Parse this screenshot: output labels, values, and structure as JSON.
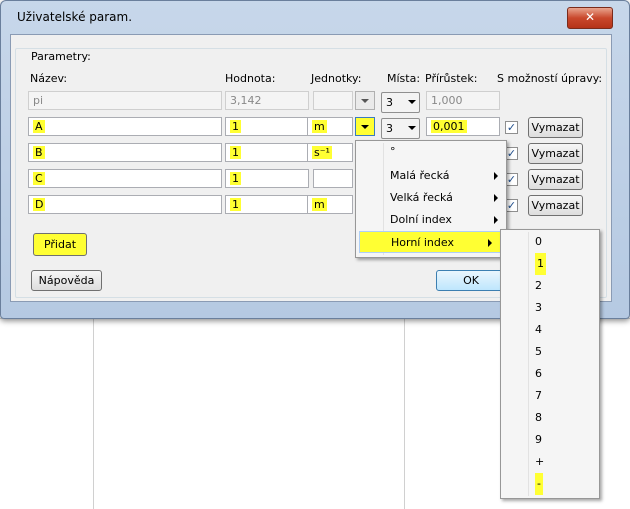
{
  "window": {
    "title": "Uživatelské param.",
    "close_glyph": "✕"
  },
  "group_title": "Parametry:",
  "headers": {
    "name": "Název:",
    "value": "Hodnota:",
    "units": "Jednotky:",
    "places": "Místa:",
    "increment": "Přírůstek:",
    "editable": "S možností úpravy:"
  },
  "rows": [
    {
      "name": "pi",
      "value": "3,142",
      "unit": "",
      "places": "3",
      "increment": "1,000",
      "disabled": true
    },
    {
      "name": "A",
      "value": "1",
      "unit": "m",
      "places": "3",
      "increment": "0,001",
      "checked": true
    },
    {
      "name": "B",
      "value": "1",
      "unit": "s⁻¹",
      "checked": true
    },
    {
      "name": "C",
      "value": "1",
      "unit": "",
      "checked": true
    },
    {
      "name": "D",
      "value": "1",
      "unit": "m",
      "checked": true
    }
  ],
  "checkmark": "✓",
  "buttons": {
    "delete": "Vymazat",
    "add": "Přidat",
    "help": "Nápověda",
    "ok": "OK"
  },
  "units_menu": {
    "items": [
      {
        "label": "°",
        "submenu": false
      },
      {
        "label": "Malá řecká",
        "submenu": true
      },
      {
        "label": "Velká řecká",
        "submenu": true
      },
      {
        "label": "Dolní index",
        "submenu": true
      },
      {
        "label": "Horní index",
        "submenu": true,
        "selected": true
      }
    ]
  },
  "superscript_menu": {
    "items": [
      "0",
      "1",
      "2",
      "3",
      "4",
      "5",
      "6",
      "7",
      "8",
      "9",
      "+",
      "-"
    ],
    "highlighted": [
      "1",
      "-"
    ]
  },
  "colors": {
    "highlight": "#ffff33",
    "title_bar": "#c7d7ea",
    "close": "#c9482c"
  }
}
